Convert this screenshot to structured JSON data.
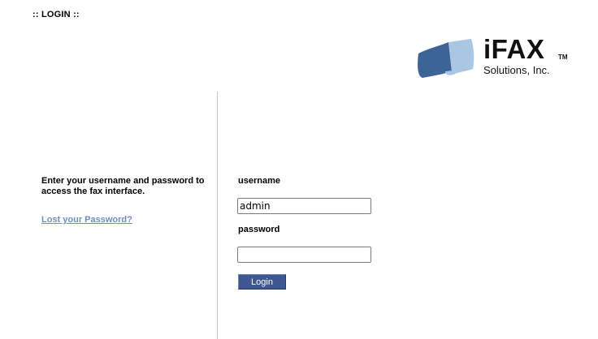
{
  "header": {
    "title": ":: LOGIN ::"
  },
  "logo": {
    "brand": "iFAX",
    "trademark": "TM",
    "subtitle": "Solutions, Inc.",
    "icon": "fax-paper-logo-icon",
    "colors": {
      "dark_sheet": "#3d6496",
      "light_sheet": "#a9c6e2"
    }
  },
  "left_panel": {
    "instructions": "Enter your username and password to access the fax interface.",
    "lost_password_link": "Lost your Password?"
  },
  "form": {
    "username_label": "username",
    "username_value": "admin",
    "password_label": "password",
    "password_value": "",
    "login_button": "Login"
  },
  "colors": {
    "button_bg": "#3e5793",
    "link": "#6d8fbd",
    "divider": "#c8c8c8"
  }
}
